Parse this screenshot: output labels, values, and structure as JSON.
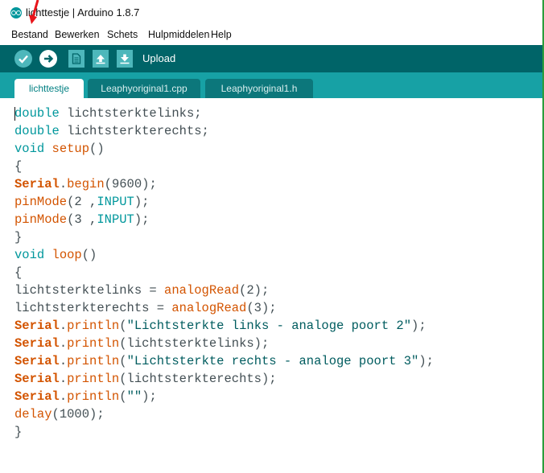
{
  "window": {
    "title": "lichttestje | Arduino 1.8.7"
  },
  "menu": {
    "items": [
      "Bestand",
      "Bewerken",
      "Schets",
      "Hulpmiddelen",
      "Help"
    ]
  },
  "toolbar": {
    "hover_label": "Upload",
    "buttons": [
      "verify-icon",
      "upload-icon",
      "new-icon",
      "open-icon",
      "save-icon"
    ]
  },
  "tabs": [
    {
      "label": "lichttestje",
      "active": true
    },
    {
      "label": "Leaphyoriginal1.cpp",
      "active": false
    },
    {
      "label": "Leaphyoriginal1.h",
      "active": false
    }
  ],
  "colors": {
    "toolbar_bg": "#006468",
    "tabbar_bg": "#17a1a5",
    "keyword": "#00979c",
    "function": "#d35400",
    "annotation_arrow": "#e8151b"
  },
  "code_lines": [
    [
      [
        "kw",
        "double"
      ],
      [
        "p",
        " lichtsterktelinks;"
      ]
    ],
    [
      [
        "kw",
        "double"
      ],
      [
        "p",
        " lichtsterkterechts;"
      ]
    ],
    [
      [
        "kw",
        "void"
      ],
      [
        "p",
        " "
      ],
      [
        "fn",
        "setup"
      ],
      [
        "p",
        "()"
      ]
    ],
    [
      [
        "p",
        "{"
      ]
    ],
    [
      [
        "bold",
        "Serial"
      ],
      [
        "p",
        "."
      ],
      [
        "fn",
        "begin"
      ],
      [
        "p",
        "(9600);"
      ]
    ],
    [
      [
        "fn",
        "pinMode"
      ],
      [
        "p",
        "(2 ,"
      ],
      [
        "const",
        "INPUT"
      ],
      [
        "p",
        ");"
      ]
    ],
    [
      [
        "fn",
        "pinMode"
      ],
      [
        "p",
        "(3 ,"
      ],
      [
        "const",
        "INPUT"
      ],
      [
        "p",
        ");"
      ]
    ],
    [
      [
        "p",
        "}"
      ]
    ],
    [
      [
        "kw",
        "void"
      ],
      [
        "p",
        " "
      ],
      [
        "fn",
        "loop"
      ],
      [
        "p",
        "()"
      ]
    ],
    [
      [
        "p",
        "{"
      ]
    ],
    [
      [
        "p",
        "lichtsterktelinks = "
      ],
      [
        "fn",
        "analogRead"
      ],
      [
        "p",
        "(2);"
      ]
    ],
    [
      [
        "p",
        "lichtsterkterechts = "
      ],
      [
        "fn",
        "analogRead"
      ],
      [
        "p",
        "(3);"
      ]
    ],
    [
      [
        "bold",
        "Serial"
      ],
      [
        "p",
        "."
      ],
      [
        "fn",
        "println"
      ],
      [
        "p",
        "("
      ],
      [
        "str",
        "\"Lichtsterkte links - analoge poort 2\""
      ],
      [
        "p",
        ");"
      ]
    ],
    [
      [
        "bold",
        "Serial"
      ],
      [
        "p",
        "."
      ],
      [
        "fn",
        "println"
      ],
      [
        "p",
        "(lichtsterktelinks);"
      ]
    ],
    [
      [
        "bold",
        "Serial"
      ],
      [
        "p",
        "."
      ],
      [
        "fn",
        "println"
      ],
      [
        "p",
        "("
      ],
      [
        "str",
        "\"Lichtsterkte rechts - analoge poort 3\""
      ],
      [
        "p",
        ");"
      ]
    ],
    [
      [
        "bold",
        "Serial"
      ],
      [
        "p",
        "."
      ],
      [
        "fn",
        "println"
      ],
      [
        "p",
        "(lichtsterkterechts);"
      ]
    ],
    [
      [
        "bold",
        "Serial"
      ],
      [
        "p",
        "."
      ],
      [
        "fn",
        "println"
      ],
      [
        "p",
        "("
      ],
      [
        "str",
        "\"\""
      ],
      [
        "p",
        ");"
      ]
    ],
    [
      [
        "fn",
        "delay"
      ],
      [
        "p",
        "(1000);"
      ]
    ],
    [
      [
        "p",
        "}"
      ]
    ]
  ]
}
